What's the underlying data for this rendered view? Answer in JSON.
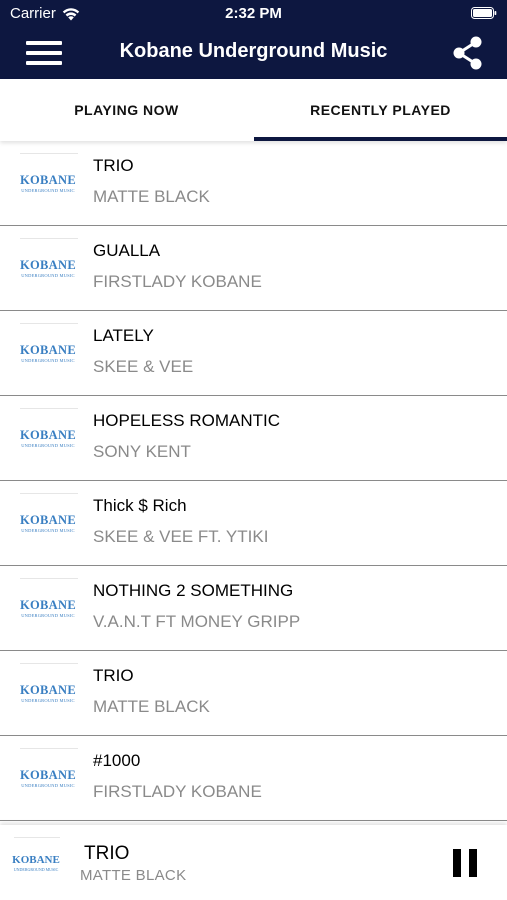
{
  "status_bar": {
    "carrier": "Carrier",
    "time": "2:32 PM"
  },
  "header": {
    "title": "Kobane Underground Music"
  },
  "tabs": [
    {
      "label": "PLAYING NOW",
      "selected": false
    },
    {
      "label": "RECENTLY PLAYED",
      "selected": true
    }
  ],
  "logo": {
    "main": "KOBANE",
    "sub": "UNDERGROUND MUSIC"
  },
  "tracks": [
    {
      "title": " TRIO",
      "artist": "MATTE BLACK"
    },
    {
      "title": "GUALLA",
      "artist": "FIRSTLADY KOBANE"
    },
    {
      "title": "LATELY",
      "artist": "SKEE & VEE"
    },
    {
      "title": "HOPELESS ROMANTIC",
      "artist": "SONY KENT"
    },
    {
      "title": "Thick $ Rich",
      "artist": "SKEE & VEE FT. YTIKI"
    },
    {
      "title": "NOTHING 2 SOMETHING",
      "artist": "V.A.N.T FT MONEY GRIPP"
    },
    {
      "title": " TRIO",
      "artist": "MATTE BLACK"
    },
    {
      "title": "#1000",
      "artist": "FIRSTLADY KOBANE"
    }
  ],
  "now_playing": {
    "title": " TRIO",
    "artist": "MATTE BLACK"
  },
  "colors": {
    "header_bg": "#0d1740",
    "logo_blue": "#3a7fc2",
    "subtitle_gray": "#8a8a8a"
  }
}
